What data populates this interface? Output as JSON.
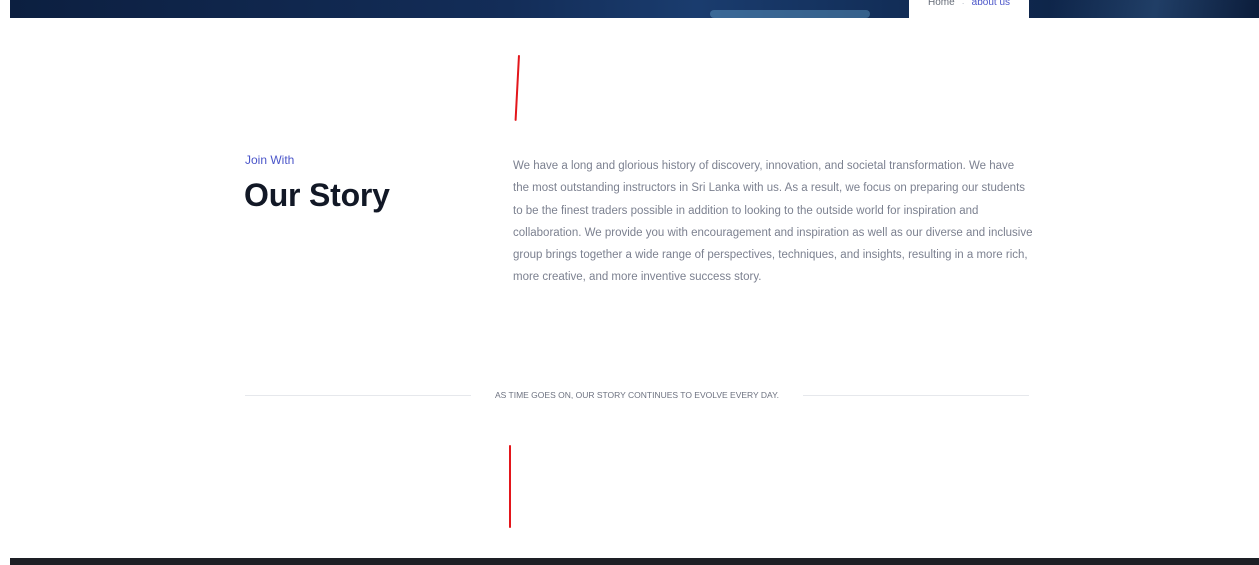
{
  "breadcrumb": {
    "home": "Home",
    "separator": "·",
    "current": "about us"
  },
  "story": {
    "eyebrow": "Join With",
    "title": "Our Story",
    "body": "We have a long and glorious history of discovery, innovation, and societal transformation. We have the most outstanding instructors in Sri Lanka with us. As a result, we focus on preparing our students to be the finest traders possible in addition to looking to the outside world for inspiration and collaboration. We provide you with encouragement and inspiration as well as our diverse and inclusive group brings together a wide range of perspectives, techniques, and insights, resulting in a more rich, more creative, and more inventive success story."
  },
  "tagline": "AS TIME GOES ON, OUR STORY CONTINUES TO EVOLVE EVERY DAY.",
  "colors": {
    "accent": "#4a55c9",
    "annotation_red": "#e3161b",
    "hero_navy": "#132d58",
    "footer_dark": "#1d1f25",
    "title_text": "#121826",
    "body_text": "#7c8190"
  }
}
